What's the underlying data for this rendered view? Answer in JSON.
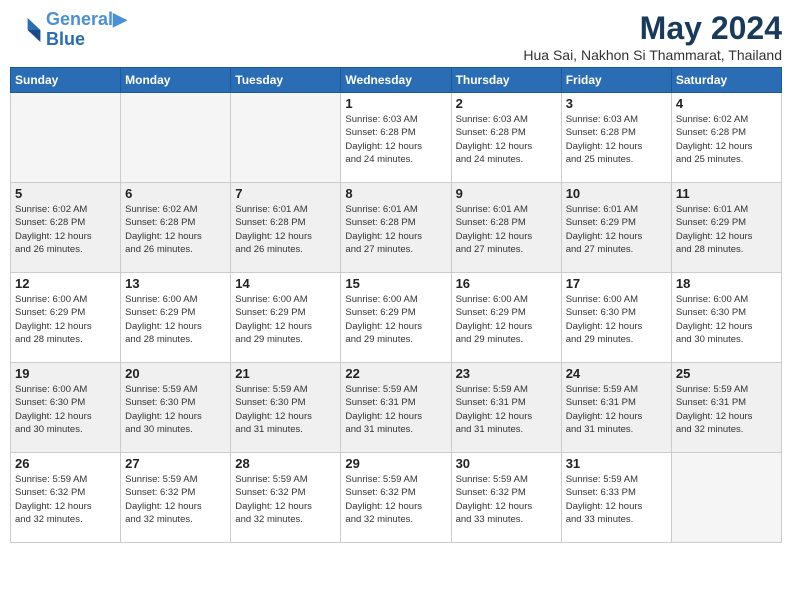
{
  "logo": {
    "line1": "General",
    "line2": "Blue"
  },
  "title": "May 2024",
  "location": "Hua Sai, Nakhon Si Thammarat, Thailand",
  "weekdays": [
    "Sunday",
    "Monday",
    "Tuesday",
    "Wednesday",
    "Thursday",
    "Friday",
    "Saturday"
  ],
  "weeks": [
    {
      "shaded": false,
      "days": [
        {
          "num": "",
          "info": "",
          "empty": true
        },
        {
          "num": "",
          "info": "",
          "empty": true
        },
        {
          "num": "",
          "info": "",
          "empty": true
        },
        {
          "num": "1",
          "info": "Sunrise: 6:03 AM\nSunset: 6:28 PM\nDaylight: 12 hours\nand 24 minutes.",
          "empty": false
        },
        {
          "num": "2",
          "info": "Sunrise: 6:03 AM\nSunset: 6:28 PM\nDaylight: 12 hours\nand 24 minutes.",
          "empty": false
        },
        {
          "num": "3",
          "info": "Sunrise: 6:03 AM\nSunset: 6:28 PM\nDaylight: 12 hours\nand 25 minutes.",
          "empty": false
        },
        {
          "num": "4",
          "info": "Sunrise: 6:02 AM\nSunset: 6:28 PM\nDaylight: 12 hours\nand 25 minutes.",
          "empty": false
        }
      ]
    },
    {
      "shaded": true,
      "days": [
        {
          "num": "5",
          "info": "Sunrise: 6:02 AM\nSunset: 6:28 PM\nDaylight: 12 hours\nand 26 minutes.",
          "empty": false
        },
        {
          "num": "6",
          "info": "Sunrise: 6:02 AM\nSunset: 6:28 PM\nDaylight: 12 hours\nand 26 minutes.",
          "empty": false
        },
        {
          "num": "7",
          "info": "Sunrise: 6:01 AM\nSunset: 6:28 PM\nDaylight: 12 hours\nand 26 minutes.",
          "empty": false
        },
        {
          "num": "8",
          "info": "Sunrise: 6:01 AM\nSunset: 6:28 PM\nDaylight: 12 hours\nand 27 minutes.",
          "empty": false
        },
        {
          "num": "9",
          "info": "Sunrise: 6:01 AM\nSunset: 6:28 PM\nDaylight: 12 hours\nand 27 minutes.",
          "empty": false
        },
        {
          "num": "10",
          "info": "Sunrise: 6:01 AM\nSunset: 6:29 PM\nDaylight: 12 hours\nand 27 minutes.",
          "empty": false
        },
        {
          "num": "11",
          "info": "Sunrise: 6:01 AM\nSunset: 6:29 PM\nDaylight: 12 hours\nand 28 minutes.",
          "empty": false
        }
      ]
    },
    {
      "shaded": false,
      "days": [
        {
          "num": "12",
          "info": "Sunrise: 6:00 AM\nSunset: 6:29 PM\nDaylight: 12 hours\nand 28 minutes.",
          "empty": false
        },
        {
          "num": "13",
          "info": "Sunrise: 6:00 AM\nSunset: 6:29 PM\nDaylight: 12 hours\nand 28 minutes.",
          "empty": false
        },
        {
          "num": "14",
          "info": "Sunrise: 6:00 AM\nSunset: 6:29 PM\nDaylight: 12 hours\nand 29 minutes.",
          "empty": false
        },
        {
          "num": "15",
          "info": "Sunrise: 6:00 AM\nSunset: 6:29 PM\nDaylight: 12 hours\nand 29 minutes.",
          "empty": false
        },
        {
          "num": "16",
          "info": "Sunrise: 6:00 AM\nSunset: 6:29 PM\nDaylight: 12 hours\nand 29 minutes.",
          "empty": false
        },
        {
          "num": "17",
          "info": "Sunrise: 6:00 AM\nSunset: 6:30 PM\nDaylight: 12 hours\nand 29 minutes.",
          "empty": false
        },
        {
          "num": "18",
          "info": "Sunrise: 6:00 AM\nSunset: 6:30 PM\nDaylight: 12 hours\nand 30 minutes.",
          "empty": false
        }
      ]
    },
    {
      "shaded": true,
      "days": [
        {
          "num": "19",
          "info": "Sunrise: 6:00 AM\nSunset: 6:30 PM\nDaylight: 12 hours\nand 30 minutes.",
          "empty": false
        },
        {
          "num": "20",
          "info": "Sunrise: 5:59 AM\nSunset: 6:30 PM\nDaylight: 12 hours\nand 30 minutes.",
          "empty": false
        },
        {
          "num": "21",
          "info": "Sunrise: 5:59 AM\nSunset: 6:30 PM\nDaylight: 12 hours\nand 31 minutes.",
          "empty": false
        },
        {
          "num": "22",
          "info": "Sunrise: 5:59 AM\nSunset: 6:31 PM\nDaylight: 12 hours\nand 31 minutes.",
          "empty": false
        },
        {
          "num": "23",
          "info": "Sunrise: 5:59 AM\nSunset: 6:31 PM\nDaylight: 12 hours\nand 31 minutes.",
          "empty": false
        },
        {
          "num": "24",
          "info": "Sunrise: 5:59 AM\nSunset: 6:31 PM\nDaylight: 12 hours\nand 31 minutes.",
          "empty": false
        },
        {
          "num": "25",
          "info": "Sunrise: 5:59 AM\nSunset: 6:31 PM\nDaylight: 12 hours\nand 32 minutes.",
          "empty": false
        }
      ]
    },
    {
      "shaded": false,
      "days": [
        {
          "num": "26",
          "info": "Sunrise: 5:59 AM\nSunset: 6:32 PM\nDaylight: 12 hours\nand 32 minutes.",
          "empty": false
        },
        {
          "num": "27",
          "info": "Sunrise: 5:59 AM\nSunset: 6:32 PM\nDaylight: 12 hours\nand 32 minutes.",
          "empty": false
        },
        {
          "num": "28",
          "info": "Sunrise: 5:59 AM\nSunset: 6:32 PM\nDaylight: 12 hours\nand 32 minutes.",
          "empty": false
        },
        {
          "num": "29",
          "info": "Sunrise: 5:59 AM\nSunset: 6:32 PM\nDaylight: 12 hours\nand 32 minutes.",
          "empty": false
        },
        {
          "num": "30",
          "info": "Sunrise: 5:59 AM\nSunset: 6:32 PM\nDaylight: 12 hours\nand 33 minutes.",
          "empty": false
        },
        {
          "num": "31",
          "info": "Sunrise: 5:59 AM\nSunset: 6:33 PM\nDaylight: 12 hours\nand 33 minutes.",
          "empty": false
        },
        {
          "num": "",
          "info": "",
          "empty": true
        }
      ]
    }
  ]
}
